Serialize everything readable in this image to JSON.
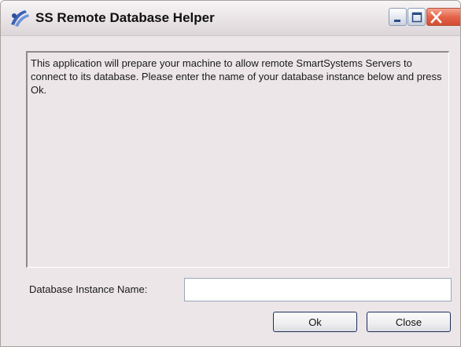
{
  "window": {
    "title": "SS Remote Database Helper",
    "title_icon": "app-logo-icon",
    "controls": {
      "minimize_icon": "minimize-icon",
      "maximize_icon": "maximize-icon",
      "close_icon": "close-icon"
    }
  },
  "message": {
    "text": "This application will prepare your machine to allow remote SmartSystems Servers to connect to its database.  Please enter the name of your database instance below and press Ok."
  },
  "form": {
    "instance_label": "Database Instance Name:",
    "instance_value": "",
    "instance_placeholder": ""
  },
  "buttons": {
    "ok_label": "Ok",
    "close_label": "Close"
  },
  "colors": {
    "window_bg": "#ece6e9",
    "close_button": "#d24c33",
    "button_border": "#1c2f5a"
  }
}
